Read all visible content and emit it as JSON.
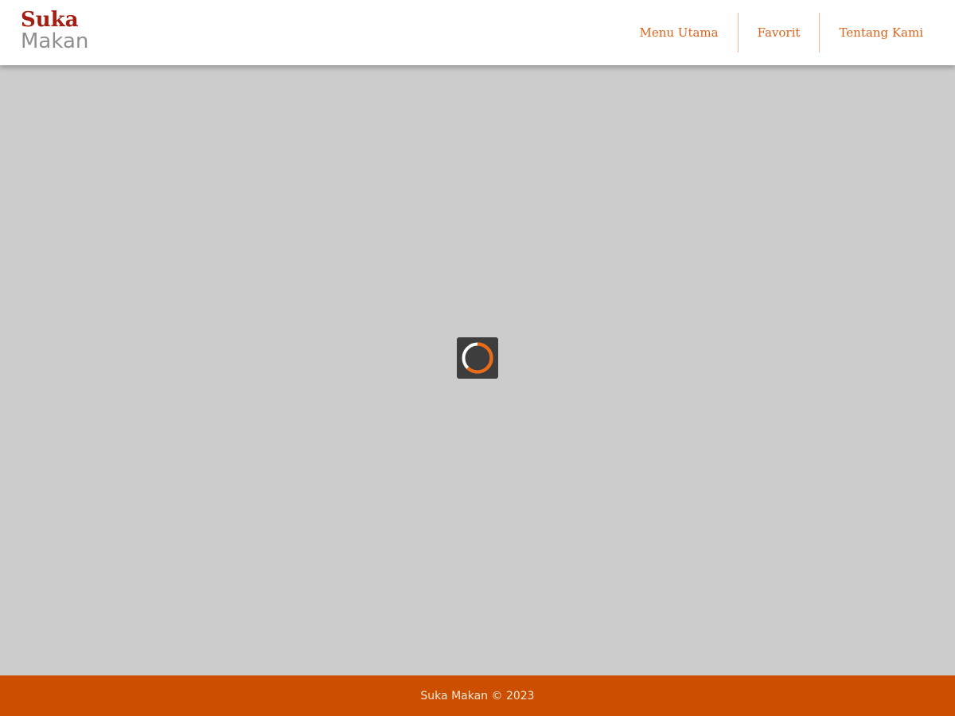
{
  "header": {
    "logo": {
      "line1": "Suka",
      "line2": "Makan"
    },
    "nav": [
      {
        "label": "Menu Utama"
      },
      {
        "label": "Favorit"
      },
      {
        "label": "Tentang Kami"
      }
    ]
  },
  "main": {
    "loading_indicator": {
      "icon": "spinner-icon",
      "state": "loading"
    }
  },
  "footer": {
    "text": "Suka Makan © 2023"
  },
  "colors": {
    "accent": "#d9631a",
    "logo_primary": "#a51d10",
    "logo_secondary": "#8f8f8f",
    "page_background": "#cccccc",
    "footer_background": "#cc4f00",
    "loader_background": "#3d3d3d"
  }
}
